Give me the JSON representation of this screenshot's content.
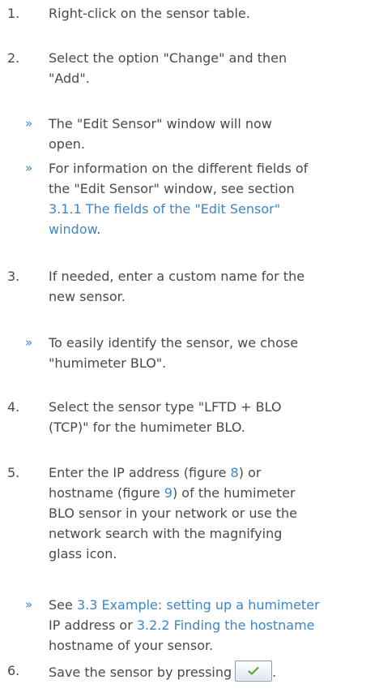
{
  "steps": [
    {
      "num": "1.",
      "lines": [
        "Right-click on the sensor table."
      ]
    },
    {
      "num": "2.",
      "lines": [
        "Select the option \"Change\" and then",
        "\"Add\"."
      ]
    },
    {
      "num": "3.",
      "lines": [
        "If needed, enter a custom name for the",
        "new sensor."
      ]
    },
    {
      "num": "4.",
      "lines": [
        "Select the sensor type \"LFTD + BLO",
        "(TCP)\" for the humimeter BLO."
      ]
    },
    {
      "num": "5.",
      "line1_a": "Enter the IP address (figure ",
      "line1_link": "8",
      "line1_b": ") or",
      "line2_a": "hostname (figure ",
      "line2_link": "9",
      "line2_b": ") of the humimeter",
      "line3": "BLO sensor in your network or use the",
      "line4": "network search with the magnifying",
      "line5": "glass icon."
    },
    {
      "num": "6.",
      "text": "Save the sensor by pressing",
      "after": "."
    }
  ],
  "notes": [
    {
      "bullet": "»",
      "lines": [
        "The \"Edit Sensor\" window will now",
        "open."
      ]
    },
    {
      "bullet": "»",
      "line1": "For information on the different fields of",
      "line2": "the \"Edit Sensor\" window, see section",
      "link1": "3.1.1 The fields of the \"Edit Sensor\"",
      "link2": "window",
      "after": "."
    },
    {
      "bullet": "»",
      "lines": [
        "To easily identify the sensor, we chose",
        "\"humimeter BLO\"."
      ]
    },
    {
      "bullet": "»",
      "a": "See ",
      "link1": "3.3 Example: setting up a humimeter",
      "b": "IP address or ",
      "link2": "3.2.2 Finding the hostname",
      "c": "hostname of your sensor."
    }
  ],
  "icons": {
    "save_button_icon": "checkmark-icon",
    "accent_color": "#3f86c4",
    "check_color": "#5aa83a"
  }
}
